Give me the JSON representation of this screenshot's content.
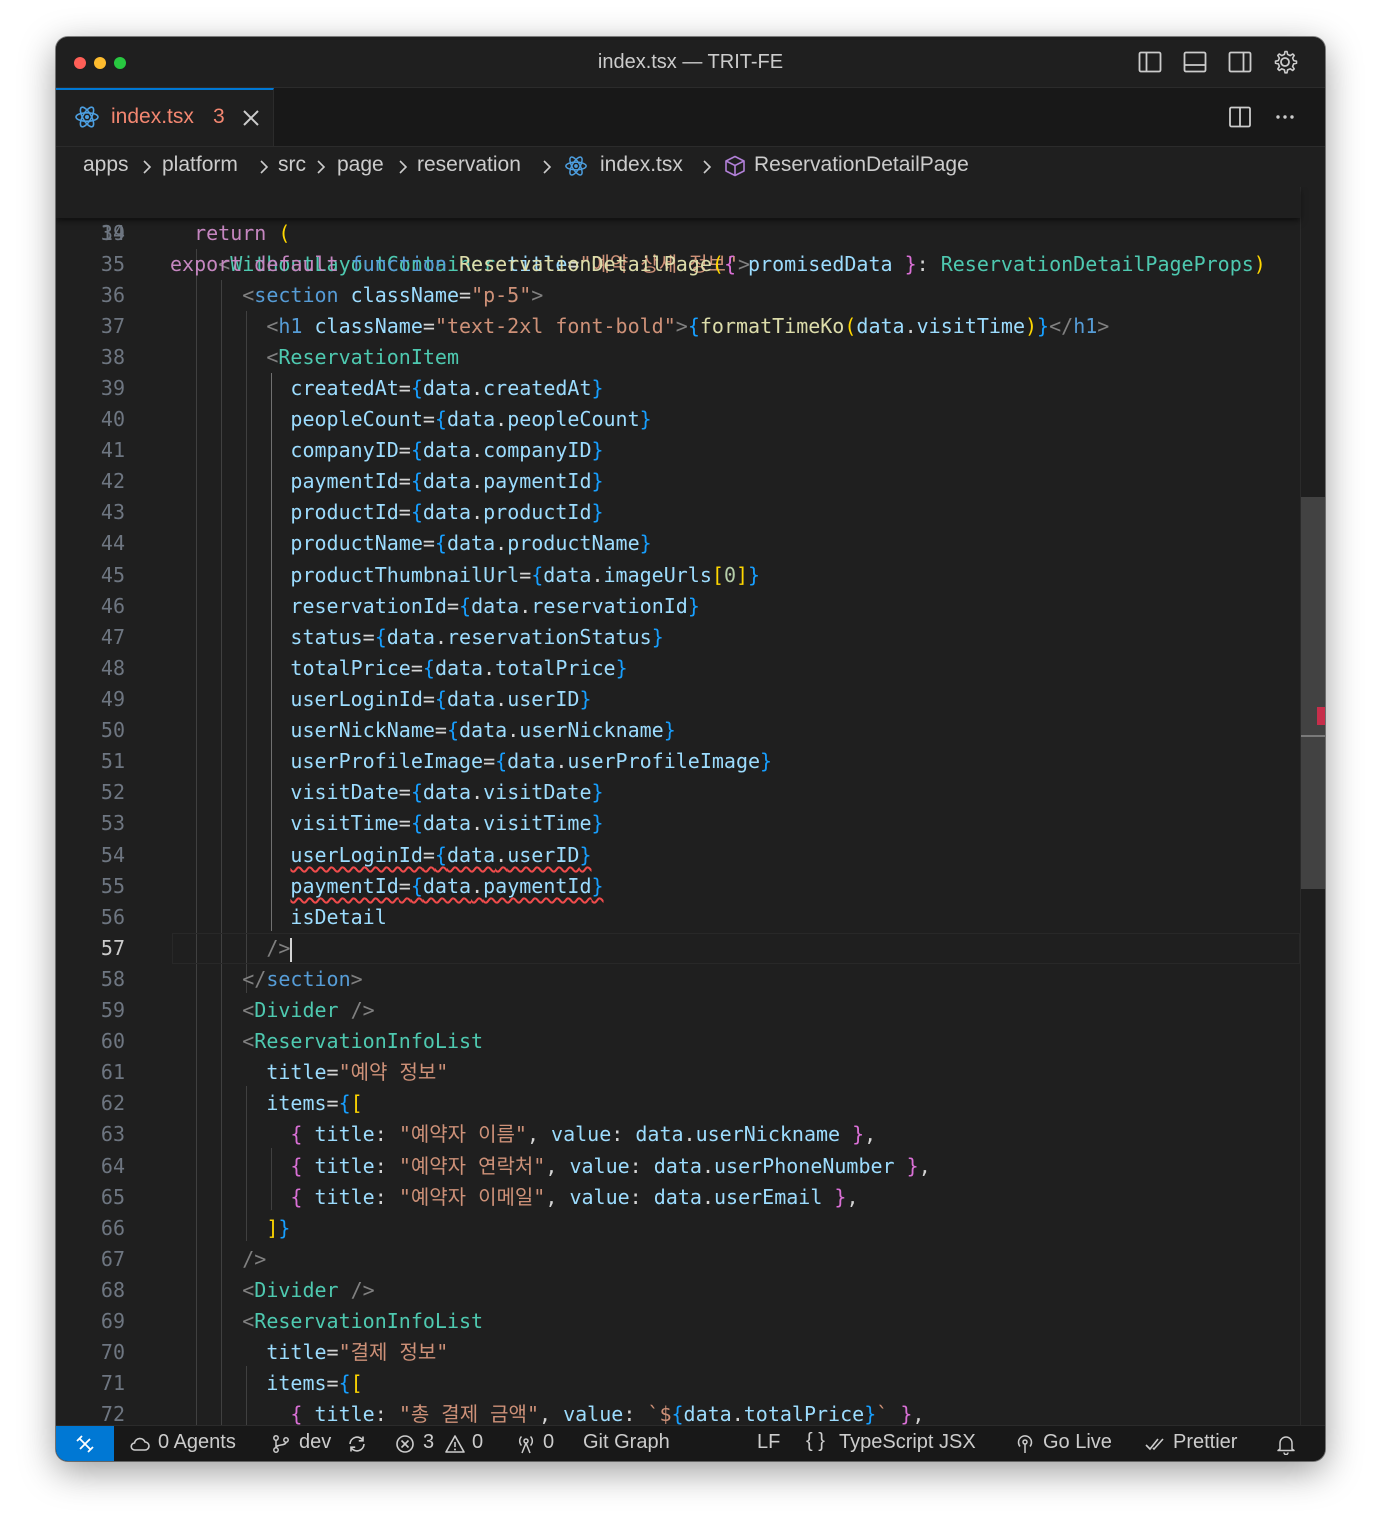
{
  "window": {
    "title": "index.tsx — TRIT-FE"
  },
  "tab": {
    "label": "index.tsx",
    "problems": "3"
  },
  "breadcrumb": [
    "apps",
    "platform",
    "src",
    "page",
    "reservation",
    "index.tsx",
    "ReservationDetailPage"
  ],
  "sticky": {
    "line": "19"
  },
  "lines": [
    {
      "n": "34"
    },
    {
      "n": "35"
    },
    {
      "n": "36"
    },
    {
      "n": "37"
    },
    {
      "n": "38"
    },
    {
      "n": "39"
    },
    {
      "n": "40"
    },
    {
      "n": "41"
    },
    {
      "n": "42"
    },
    {
      "n": "43"
    },
    {
      "n": "44"
    },
    {
      "n": "45"
    },
    {
      "n": "46"
    },
    {
      "n": "47"
    },
    {
      "n": "48"
    },
    {
      "n": "49"
    },
    {
      "n": "50"
    },
    {
      "n": "51"
    },
    {
      "n": "52"
    },
    {
      "n": "53"
    },
    {
      "n": "54"
    },
    {
      "n": "55"
    },
    {
      "n": "56"
    },
    {
      "n": "57"
    },
    {
      "n": "58"
    },
    {
      "n": "59"
    },
    {
      "n": "60"
    },
    {
      "n": "61"
    },
    {
      "n": "62"
    },
    {
      "n": "63"
    },
    {
      "n": "64"
    },
    {
      "n": "65"
    },
    {
      "n": "66"
    },
    {
      "n": "67"
    },
    {
      "n": "68"
    },
    {
      "n": "69"
    },
    {
      "n": "70"
    },
    {
      "n": "71"
    },
    {
      "n": "72"
    }
  ],
  "code": {
    "export": "export",
    "default": "default",
    "function": "function",
    "fn_name": "ReservationDetailPage",
    "promisedData": "promisedData",
    "props_type": "ReservationDetailPageProps",
    "return": "return",
    "WithoutLayoutContainer": "WithoutLayoutContainer",
    "title_attr": "title",
    "title_value_1": "\"예약 상세 정보\"",
    "section": "section",
    "className": "className",
    "p5": "\"p-5\"",
    "h1": "h1",
    "h1_class": "\"text-2xl font-bold\"",
    "formatTimeKo": "formatTimeKo",
    "data": "data",
    "visitTime": "visitTime",
    "ReservationItem": "ReservationItem",
    "createdAt": "createdAt",
    "peopleCount": "peopleCount",
    "companyID": "companyID",
    "paymentId": "paymentId",
    "productId": "productId",
    "productName": "productName",
    "productThumbnailUrl": "productThumbnailUrl",
    "imageUrls": "imageUrls",
    "zero": "0",
    "reservationId": "reservationId",
    "status": "status",
    "reservationStatus": "reservationStatus",
    "totalPrice": "totalPrice",
    "userLoginId": "userLoginId",
    "userID": "userID",
    "userNickName": "userNickName",
    "userNickname": "userNickname",
    "userProfileImage": "userProfileImage",
    "visitDate": "visitDate",
    "isDetail": "isDetail",
    "Divider": "Divider",
    "ReservationInfoList": "ReservationInfoList",
    "title_value_2": "\"예약 정보\"",
    "items": "items",
    "title_key": "title",
    "value_key": "value",
    "reserver_name": "\"예약자 이름\"",
    "reserver_contact": "\"예약자 연락처\"",
    "userPhoneNumber": "userPhoneNumber",
    "reserver_email": "\"예약자 이메일\"",
    "userEmail": "userEmail",
    "title_value_3": "\"결제 정보\"",
    "total_payment": "\"총 결제 금액\"",
    "template_start": "`$",
    "template_end": "`"
  },
  "status": {
    "agents": "0 Agents",
    "branch": "dev",
    "errors": "3",
    "warnings": "0",
    "ports": "0",
    "git_graph": "Git Graph",
    "eol": "LF",
    "language": "TypeScript JSX",
    "go_live": "Go Live",
    "prettier": "Prettier"
  },
  "colors": {
    "accent": "#0078d4",
    "error_tab": "#f48771",
    "background": "#1f1f1f"
  }
}
